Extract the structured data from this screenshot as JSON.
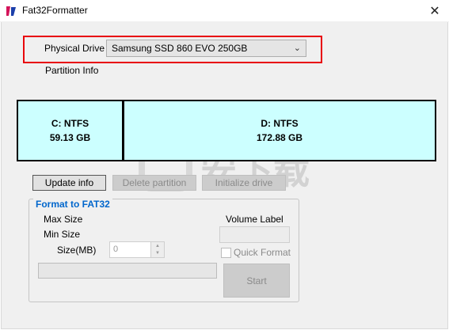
{
  "window": {
    "title": "Fat32Formatter",
    "close_glyph": "✕"
  },
  "drive": {
    "label": "Physical Drive",
    "selected": "Samsung SSD 860 EVO 250GB",
    "chevron": "⌄"
  },
  "partition_info_label": "Partition Info",
  "partitions": [
    {
      "name": "C: NTFS",
      "size": "59.13 GB"
    },
    {
      "name": "D: NTFS",
      "size": "172.88 GB"
    }
  ],
  "buttons": {
    "update_info": "Update info",
    "delete_partition": "Delete partition",
    "initialize_drive": "Initialize drive"
  },
  "format_group": {
    "title": "Format to FAT32",
    "max_size_label": "Max Size",
    "min_size_label": "Min Size",
    "size_mb_label": "Size(MB)",
    "size_value": "0",
    "volume_label_label": "Volume Label",
    "volume_label_value": "",
    "quick_format_label": "Quick Format",
    "quick_format_checked": false,
    "start_label": "Start",
    "stepper_up": "▲",
    "stepper_down": "▼"
  },
  "watermark": {
    "text": "安下载"
  },
  "colors": {
    "highlight_border": "#e8000b",
    "partition_fill": "#ccffff",
    "group_title": "#0066cc"
  }
}
